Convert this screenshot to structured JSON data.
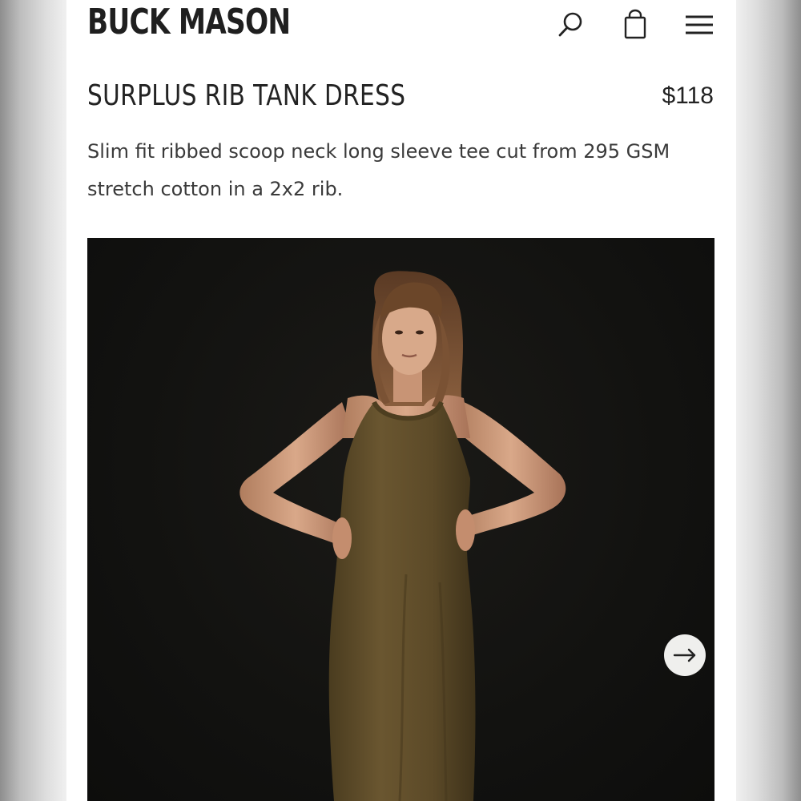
{
  "header": {
    "logo": "BUCK MASON",
    "icons": [
      "search-icon",
      "shopping-bag-icon",
      "hamburger-menu-icon"
    ]
  },
  "product": {
    "title": "SURPLUS RIB TANK DRESS",
    "price": "$118",
    "description": "Slim fit ribbed scoop neck long sleeve tee cut from 295 GSM stretch cotton in a 2x2 rib."
  },
  "gallery": {
    "image_subject": "model wearing olive tank dress",
    "next_icon": "arrow-right-icon"
  },
  "colors": {
    "text": "#232323",
    "photo_background": "#121210",
    "dress_olive": "#5e4d2a",
    "next_button_bg": "#efefed"
  }
}
